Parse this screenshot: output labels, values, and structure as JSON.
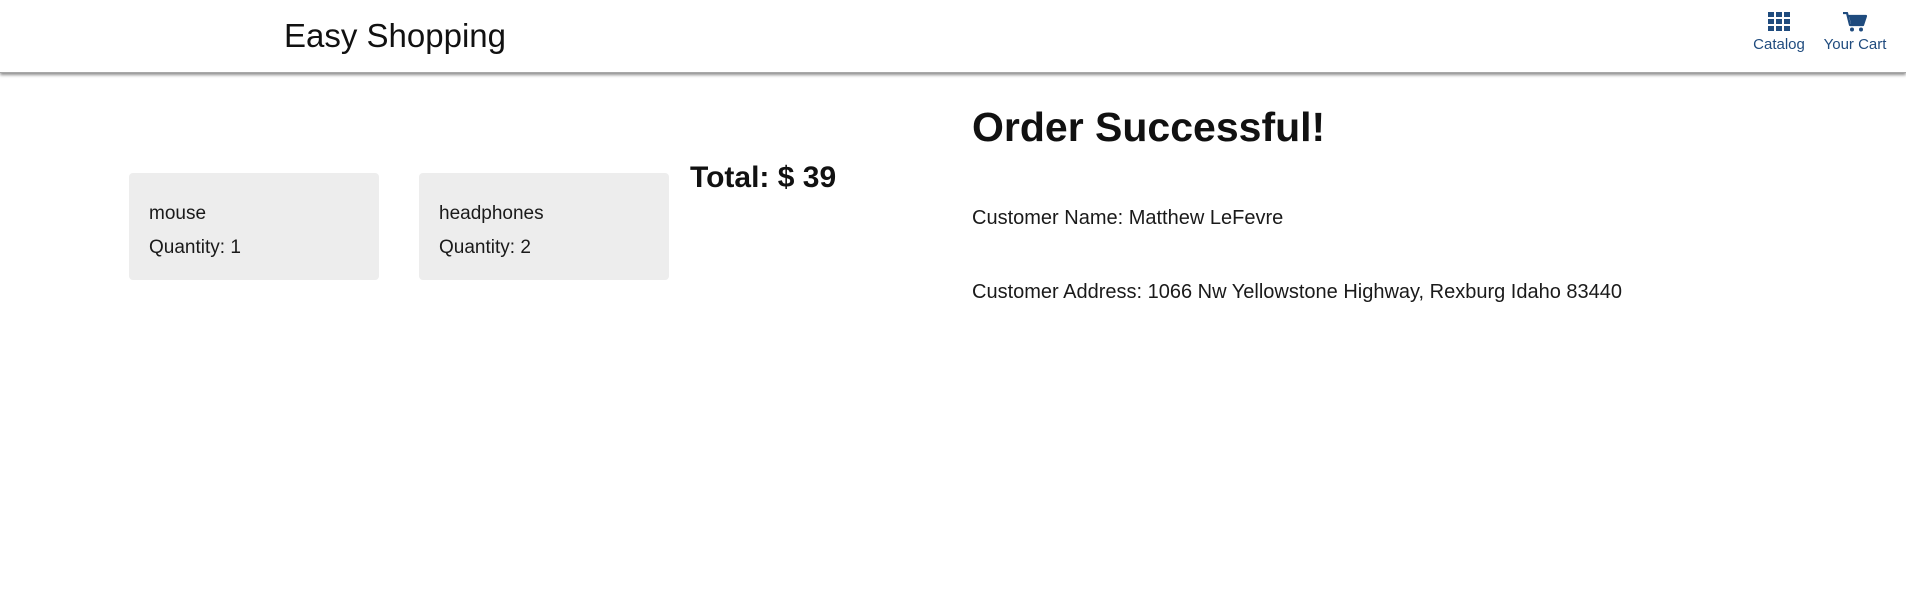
{
  "header": {
    "title": "Easy Shopping",
    "nav": {
      "catalog_label": "Catalog",
      "catalog_icon": "grid-icon",
      "cart_label": "Your Cart",
      "cart_icon": "cart-icon"
    }
  },
  "cart": {
    "items": [
      {
        "name": "mouse",
        "quantity_text": "Quantity: 1"
      },
      {
        "name": "headphones",
        "quantity_text": "Quantity: 2"
      }
    ],
    "total_text": "Total: $ 39"
  },
  "order": {
    "heading": "Order Successful!",
    "customer_name_text": "Customer Name: Matthew LeFevre",
    "customer_address_text": "Customer Address: 1066 Nw Yellowstone Highway, Rexburg Idaho 83440"
  },
  "colors": {
    "nav_blue": "#1f4b7e",
    "card_background": "#ededed"
  }
}
